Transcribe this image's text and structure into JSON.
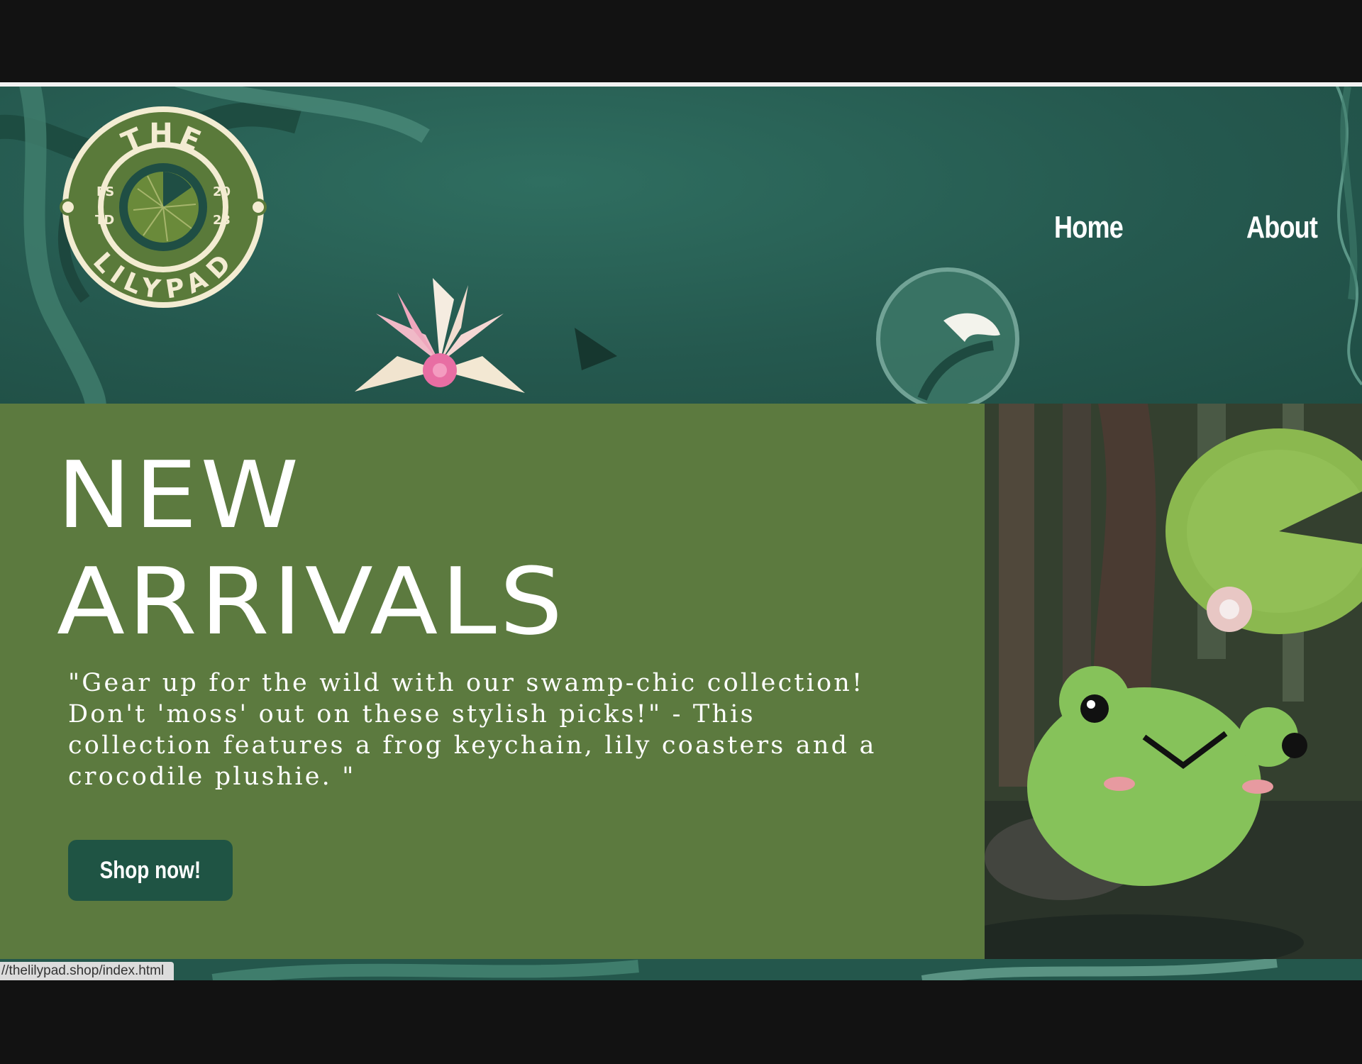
{
  "brand": {
    "logo_top_text": "THE",
    "logo_bottom_text": "LILYPAD",
    "logo_left_top": "ES",
    "logo_left_bottom": "TD",
    "logo_right_top": "20",
    "logo_right_bottom": "23"
  },
  "nav": {
    "items": [
      {
        "label": "Home"
      },
      {
        "label": "About"
      }
    ]
  },
  "hero": {
    "title_line1": "NEW",
    "title_line2": "ARRIVALS",
    "description": "\"Gear up for the wild with our swamp-chic collection! Don't 'moss' out on these stylish picks!\" - This collection features a frog keychain, lily coasters and a crocodile plushie. \"",
    "cta_label": "Shop now!"
  },
  "status_bar": {
    "url": "//thelilypad.shop/index.html"
  },
  "colors": {
    "hero_bg": "#5c7a3f",
    "header_bg": "#25594f",
    "button_bg": "#1f5444",
    "logo_green": "#5a7a3a",
    "logo_cream": "#f3ecd2"
  },
  "icons": {
    "logo": "lilypad-logo-icon",
    "flower": "lotus-flower-icon",
    "bubble": "bubble-icon"
  }
}
